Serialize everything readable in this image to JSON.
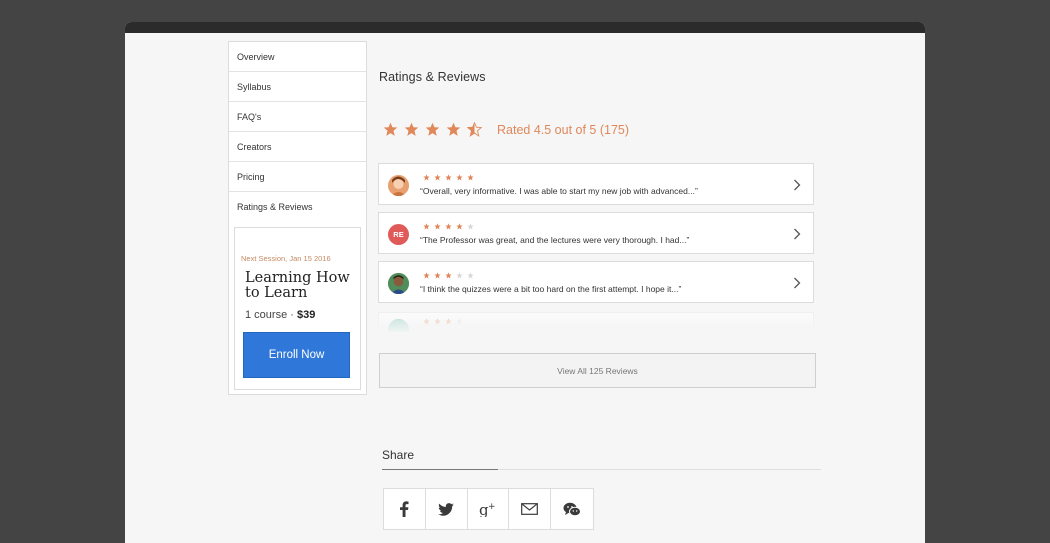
{
  "sidebar": {
    "items": [
      {
        "label": "Overview"
      },
      {
        "label": "Syllabus"
      },
      {
        "label": "FAQ's"
      },
      {
        "label": "Creators"
      },
      {
        "label": "Pricing"
      },
      {
        "label": "Ratings & Reviews"
      }
    ],
    "promo": {
      "session": "Next Session, Jan 15 2016",
      "title": "Learning How to Learn",
      "course_count": "1 course · ",
      "price": "$39",
      "enroll_label": "Enroll Now"
    }
  },
  "ratings": {
    "section_title": "Ratings & Reviews",
    "rating_value": 4.5,
    "rating_text": "Rated 4.5 out of 5 (175)",
    "star_color": "#e0885a",
    "reviews": [
      {
        "stars": 5,
        "text": "“Overall, very informative. I was able to start my new job with advanced...”",
        "avatar": "photo-avatar"
      },
      {
        "stars": 4,
        "text": "“The Professor was great, and the lectures were very thorough. I had...”",
        "avatar_initials": "RE",
        "avatar_color": "#e05a5a"
      },
      {
        "stars": 3,
        "text": "“I think the quizzes were a bit too hard on the first attempt. I hope it...”",
        "avatar": "photo-avatar"
      }
    ],
    "view_all_label": "View All 125 Reviews"
  },
  "share": {
    "title": "Share",
    "buttons": [
      {
        "icon": "facebook-icon"
      },
      {
        "icon": "twitter-icon"
      },
      {
        "icon": "google-plus-icon"
      },
      {
        "icon": "mail-icon"
      },
      {
        "icon": "wechat-icon"
      }
    ]
  }
}
